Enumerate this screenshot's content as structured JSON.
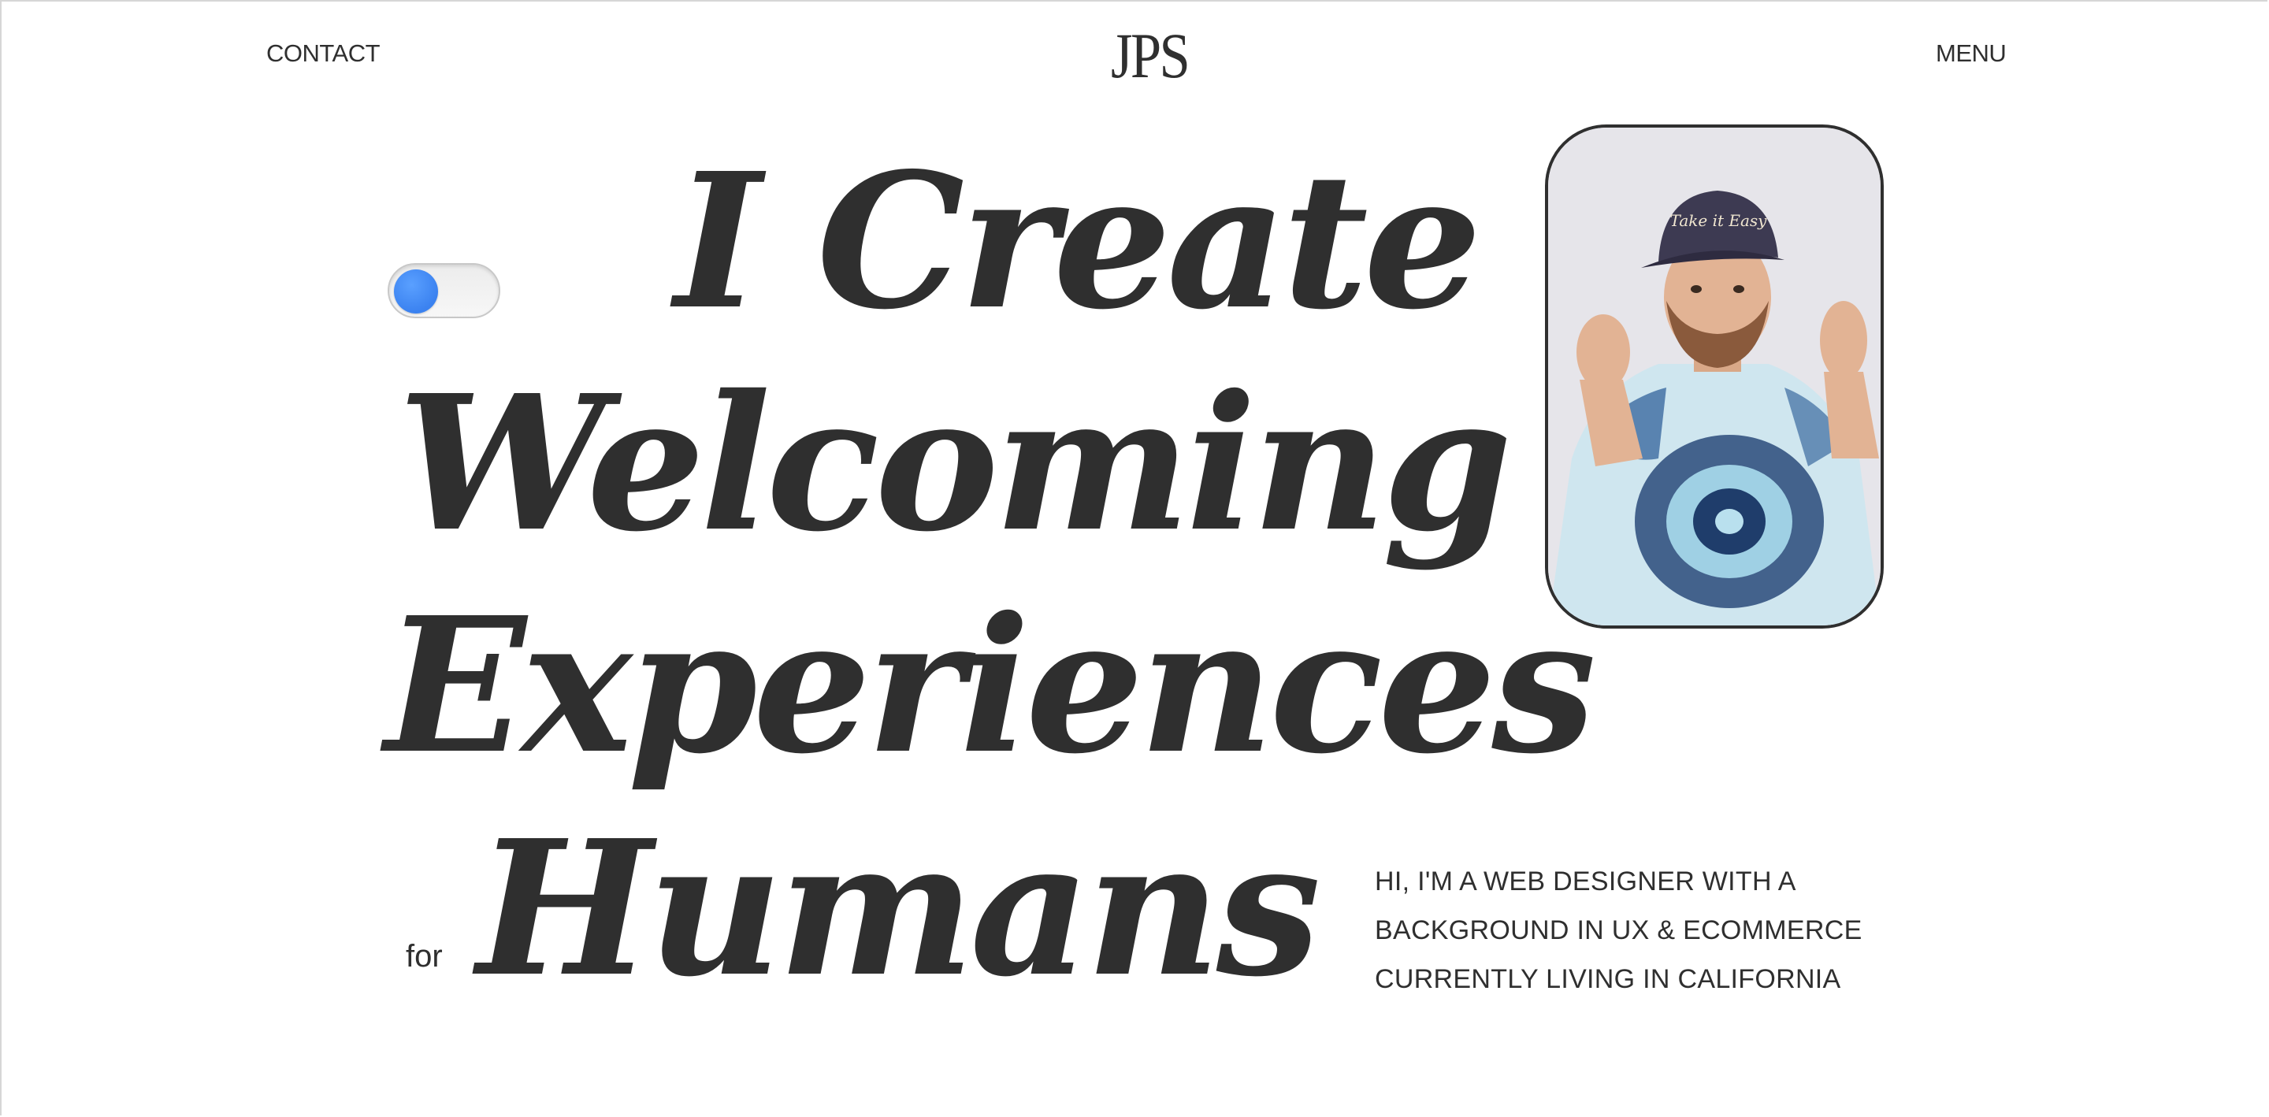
{
  "header": {
    "contact_label": "CONTACT",
    "logo_text": "JPS",
    "menu_label": "MENU"
  },
  "toggle": {
    "state": "off",
    "knob_color": "#3b82f0"
  },
  "hero": {
    "line_1": "I Create",
    "line_2": "Welcoming",
    "line_3": "Experiences",
    "for_label": "for",
    "line_4": "Humans"
  },
  "portrait": {
    "icon": "person-photo",
    "cap_text": "Take it Easy"
  },
  "intro": {
    "line_1": "HI, I'M A WEB DESIGNER WITH A",
    "line_2": "BACKGROUND IN UX & ECOMMERCE",
    "line_3": "CURRENTLY LIVING IN CALIFORNIA"
  },
  "colors": {
    "text": "#2f2f2f",
    "background": "#ffffff",
    "accent": "#3b82f0"
  }
}
